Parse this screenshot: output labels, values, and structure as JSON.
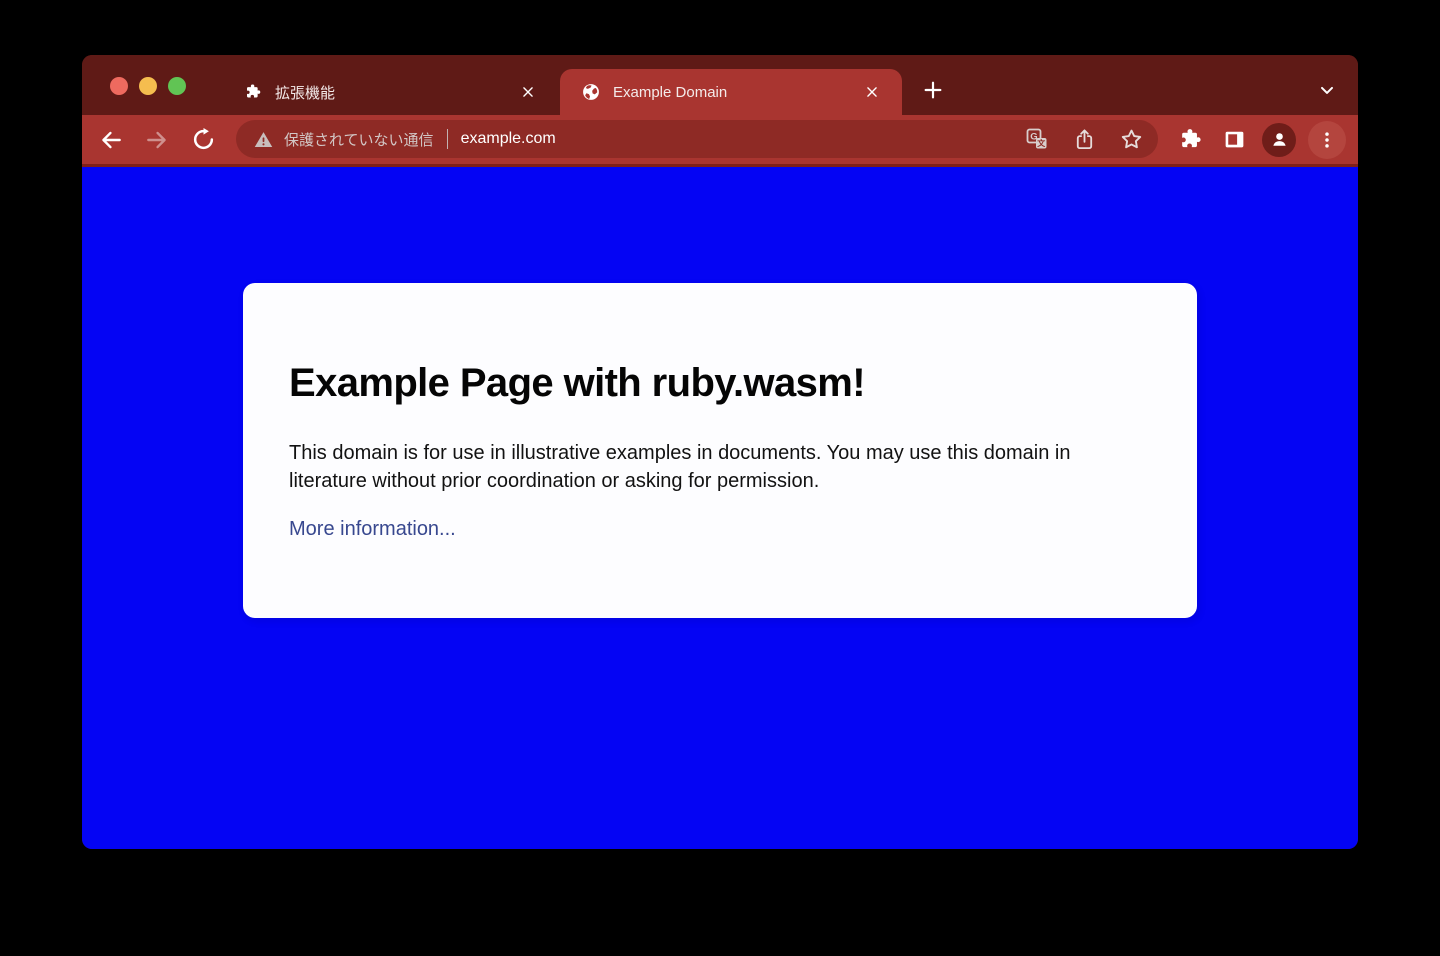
{
  "window_controls": {
    "close_color": "#ee6a5f",
    "minimize_color": "#f5bd4f",
    "maximize_color": "#61c454"
  },
  "tab_strip": {
    "tabs": [
      {
        "label": "拡張機能",
        "icon": "puzzle-icon",
        "active": false
      },
      {
        "label": "Example Domain",
        "icon": "globe-icon",
        "active": true
      }
    ],
    "new_tab_icon": "plus-icon",
    "tab_search_icon": "chevron-down-icon"
  },
  "toolbar": {
    "back_icon": "arrow-left-icon",
    "forward_icon": "arrow-right-icon",
    "reload_icon": "reload-icon",
    "address_bar": {
      "security_icon": "warning-triangle-icon",
      "security_text": "保護されていない通信",
      "url": "example.com",
      "translate_icon": "translate-icon",
      "share_icon": "share-icon",
      "bookmark_icon": "star-icon"
    },
    "extensions_icon": "puzzle-icon",
    "side_panel_icon": "side-panel-icon",
    "profile_icon": "person-icon",
    "menu_icon": "three-dot-menu-icon"
  },
  "page": {
    "heading": "Example Page with ruby.wasm!",
    "paragraph": "This domain is for use in illustrative examples in documents. You may use this domain in literature without prior coordination or asking for permission.",
    "link_text": "More information...",
    "background_color": "#0404f4",
    "card_color": "#fdfdff",
    "link_color": "#38488f"
  },
  "theme": {
    "frame_color": "#5f1a16",
    "toolbar_color": "#a93530",
    "address_bar_color": "#8e2a25"
  }
}
